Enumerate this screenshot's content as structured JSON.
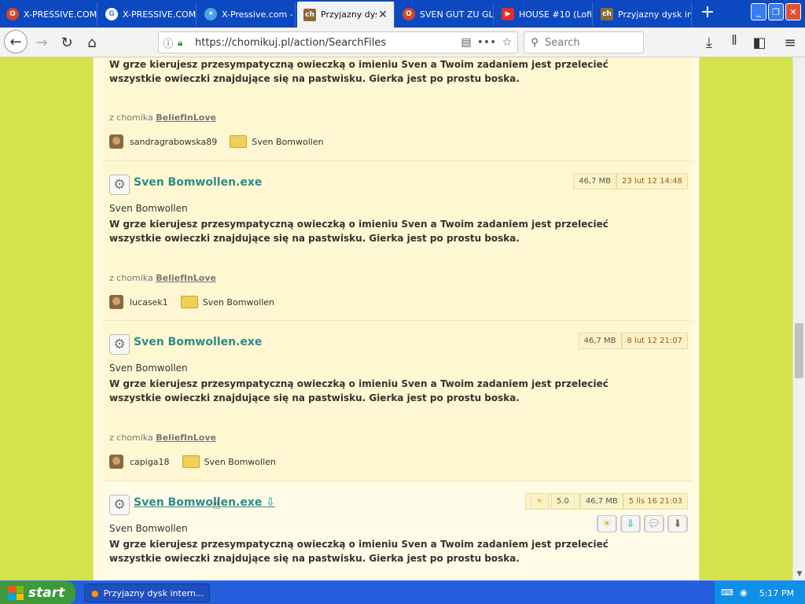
{
  "browser": {
    "tabs": [
      {
        "label": "X-PRESSIVE.COM",
        "favicon": "opera-icon",
        "color": "#d64523"
      },
      {
        "label": "X-PRESSIVE.COM",
        "favicon": "google-icon",
        "color": "#ffffff"
      },
      {
        "label": "X-Pressive.com -",
        "favicon": "sparkle-icon",
        "color": "#4aa3e6"
      },
      {
        "label": "Przyjazny dysk",
        "favicon": "chomikuj-icon",
        "color": "#8a6a3b",
        "active": true
      },
      {
        "label": "SVEN GUT ZU GL",
        "favicon": "opera-icon",
        "color": "#d64523"
      },
      {
        "label": "HOUSE #10 (Lofi",
        "favicon": "youtube-icon",
        "color": "#e52d27"
      },
      {
        "label": "Przyjazny dysk in",
        "favicon": "chomikuj-icon",
        "color": "#8a6a3b"
      }
    ],
    "url": "https://chomikuj.pl/action/SearchFiles",
    "search_placeholder": "Search"
  },
  "results": [
    {
      "desc": "W grze kierujesz przesympatyczną owieczką o imieniu Sven a Twoim zadaniem jest przelecieć wszystkie owieczki znajdujące się na pastwisku. Gierka jest po prostu boska.",
      "from_label": "z chomika",
      "from_user": "BeliefInLove",
      "owner": "sandragrabowska89",
      "folder": "Sven Bomwollen"
    },
    {
      "name": "Sven Bomwollen.exe",
      "size": "46,7 MB",
      "date": "23 lut 12 14:48",
      "title": "Sven Bomwollen",
      "desc": "W grze kierujesz przesympatyczną owieczką o imieniu Sven a Twoim zadaniem jest przelecieć wszystkie owieczki znajdujące się na pastwisku. Gierka jest po prostu boska.",
      "from_label": "z chomika",
      "from_user": "BeliefInLove",
      "owner": "lucasek1",
      "folder": "Sven Bomwollen"
    },
    {
      "name": "Sven Bomwollen.exe",
      "size": "46,7 MB",
      "date": "8 lut 12 21:07",
      "title": "Sven Bomwollen",
      "desc": "W grze kierujesz przesympatyczną owieczką o imieniu Sven a Twoim zadaniem jest przelecieć wszystkie owieczki znajdujące się na pastwisku. Gierka jest po prostu boska.",
      "from_label": "z chomika",
      "from_user": "BeliefInLove",
      "owner": "capiga18",
      "folder": "Sven Bomwollen"
    },
    {
      "name": "Sven Bomwollen.exe",
      "rating": "5.0",
      "size": "46,7 MB",
      "date": "5 lis 16 21:03",
      "title": "Sven Bomwollen",
      "desc": "W grze kierujesz przesympatyczną owieczką o imieniu Sven a Twoim zadaniem jest przelecieć wszystkie owieczki znajdujące się na pastwisku. Gierka jest po prostu boska."
    }
  ],
  "taskbar": {
    "start_label": "start",
    "task_label": "Przyjazny dysk intern...",
    "clock": "5:17 PM"
  },
  "colors": {
    "page_bg": "#d4e34c",
    "accent_link": "#2e8b8b",
    "taskbar": "#245edc"
  }
}
